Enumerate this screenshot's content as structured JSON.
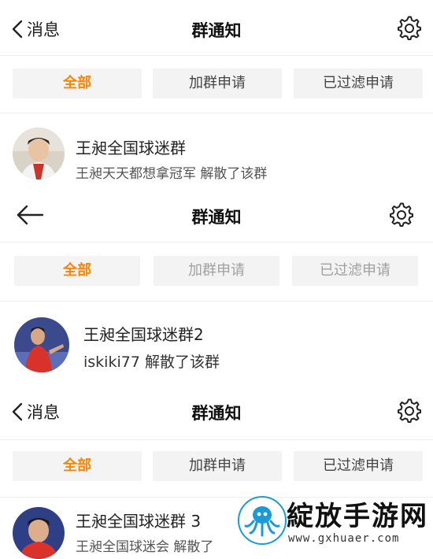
{
  "panels": [
    {
      "back_label": "消息",
      "title": "群通知",
      "filters": [
        "全部",
        "加群申请",
        "已过滤申请"
      ],
      "item": {
        "name": "王昶全国球迷群",
        "desc": "王昶天天都想拿冠军 解散了该群"
      }
    },
    {
      "back_label": "",
      "title": "群通知",
      "filters": [
        "全部",
        "加群申请",
        "已过滤申请"
      ],
      "item": {
        "name": "王昶全国球迷群2",
        "desc": "iskiki77 解散了该群"
      }
    },
    {
      "back_label": "消息",
      "title": "群通知",
      "filters": [
        "全部",
        "加群申请",
        "已过滤申请"
      ],
      "item": {
        "name": "王昶全国球迷群 3",
        "desc": "王昶全国球迷会 解散了"
      }
    }
  ],
  "watermark": {
    "brand": "綻放手游网",
    "url": "www.gxhuaer.com"
  },
  "colors": {
    "accent": "#ff8200",
    "chip_bg": "#f3f3f3",
    "divider": "#eeeeee"
  },
  "icons": {
    "back": "chevron-left-icon",
    "back_arrow": "arrow-left-icon",
    "settings": "gear-icon"
  }
}
